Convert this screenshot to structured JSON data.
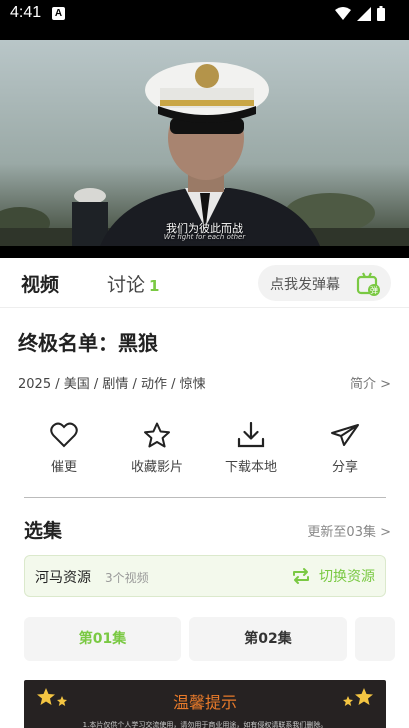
{
  "status_bar": {
    "time": "4:41",
    "notification_letter": "A"
  },
  "video": {
    "subtitle_main": "我们为彼此而战",
    "subtitle_en": "We fight for each other"
  },
  "tabs": {
    "video_label": "视频",
    "discuss_label": "讨论",
    "discuss_count": "1",
    "danmaku_label": "点我发弹幕",
    "danmaku_icon_text": "弹"
  },
  "movie": {
    "title": "终极名单：黑狼",
    "meta": "2025 / 美国 / 剧情 / 动作 / 惊悚",
    "intro_link": "简介 >"
  },
  "actions": [
    {
      "label": "催更",
      "icon": "heart-icon"
    },
    {
      "label": "收藏影片",
      "icon": "star-icon"
    },
    {
      "label": "下载本地",
      "icon": "download-icon"
    },
    {
      "label": "分享",
      "icon": "share-icon"
    }
  ],
  "episodes": {
    "title": "选集",
    "update_text": "更新至03集 >",
    "source_name": "河马资源",
    "source_count": "3个视频",
    "switch_label": "切换资源",
    "items": [
      "第01集",
      "第02集"
    ]
  },
  "notice": {
    "title": "温馨提示",
    "text": "1.本片仅供个人学习交流使用，请勿用于商业用途，如有侵权请联系我们删除。"
  },
  "colors": {
    "accent": "#7ac943",
    "notice_bg": "#262222",
    "notice_title": "#e87a2a"
  }
}
